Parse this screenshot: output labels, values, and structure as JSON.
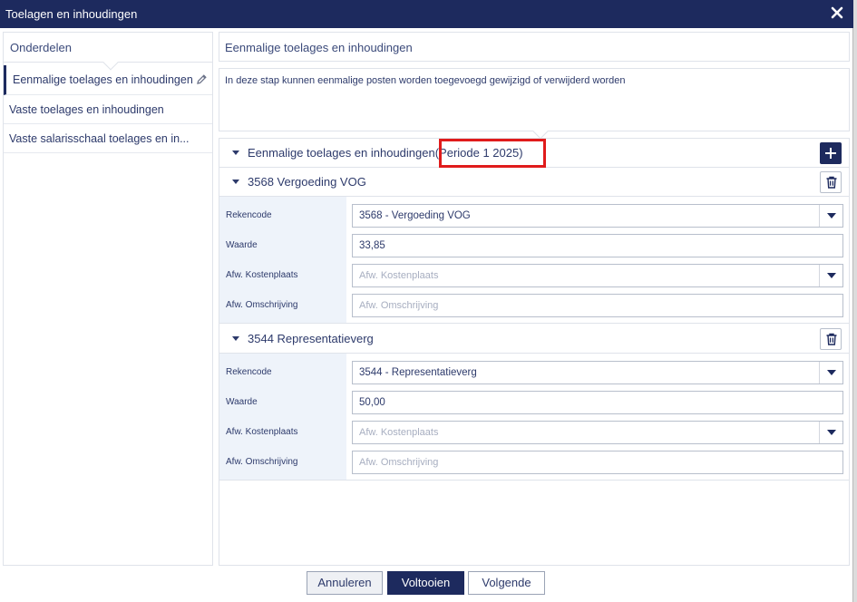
{
  "window": {
    "title": "Toelagen en inhoudingen",
    "close_icon": "close-icon"
  },
  "sidebar": {
    "header": "Onderdelen",
    "items": [
      {
        "label": "Eenmalige toelages en inhoudingen",
        "active": true,
        "icon": "pencil-icon"
      },
      {
        "label": "Vaste toelages en inhoudingen",
        "active": false
      },
      {
        "label": "Vaste salarisschaal toelages en in...",
        "active": false
      }
    ]
  },
  "main": {
    "header": "Eenmalige toelages en inhoudingen",
    "description": "In deze stap kunnen eenmalige posten worden toegevoegd gewijzigd of verwijderd worden",
    "section": {
      "title": "Eenmalige toelages en inhoudingen",
      "period": "(Periode 1 2025)",
      "add_icon": "plus-icon"
    },
    "entries": [
      {
        "title": "3568 Vergoeding VOG",
        "fields": {
          "rekencode_label": "Rekencode",
          "rekencode_value": "3568 - Vergoeding VOG",
          "waarde_label": "Waarde",
          "waarde_value": "33,85",
          "kostenplaats_label": "Afw. Kostenplaats",
          "kostenplaats_placeholder": "Afw. Kostenplaats",
          "omschrijving_label": "Afw. Omschrijving",
          "omschrijving_placeholder": "Afw. Omschrijving"
        }
      },
      {
        "title": "3544 Representatieverg",
        "fields": {
          "rekencode_label": "Rekencode",
          "rekencode_value": "3544 - Representatieverg",
          "waarde_label": "Waarde",
          "waarde_value": "50,00",
          "kostenplaats_label": "Afw. Kostenplaats",
          "kostenplaats_placeholder": "Afw. Kostenplaats",
          "omschrijving_label": "Afw. Omschrijving",
          "omschrijving_placeholder": "Afw. Omschrijving"
        }
      }
    ]
  },
  "footer": {
    "cancel_label": "Annuleren",
    "finish_label": "Voltooien",
    "next_label": "Volgende"
  },
  "colors": {
    "primary": "#1d2a5e",
    "highlight": "#e01b1b",
    "label_bg": "#eef3fa"
  }
}
